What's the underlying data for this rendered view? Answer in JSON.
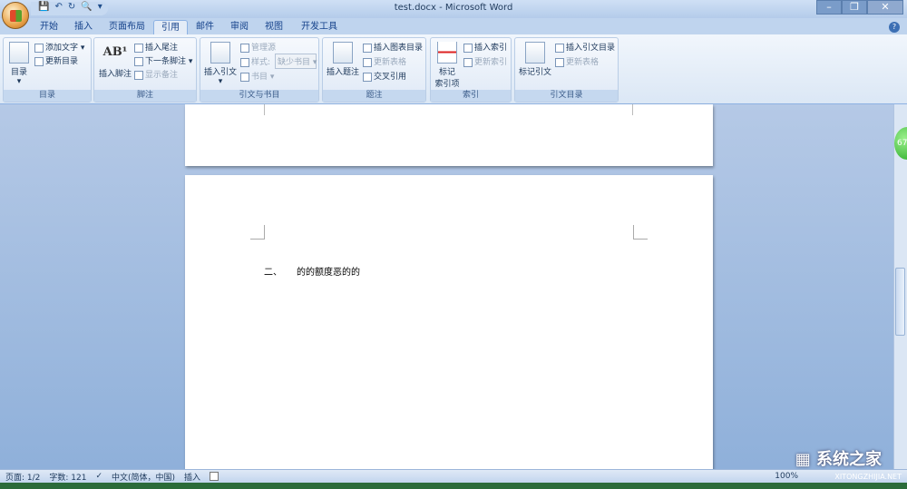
{
  "window": {
    "title": "test.docx - Microsoft Word",
    "minimize": "–",
    "restore": "❐",
    "close": "✕"
  },
  "qat": {
    "save": "💾",
    "undo": "↶",
    "redo": "↻",
    "preview": "🔍",
    "more": "▾"
  },
  "tabs": [
    "开始",
    "插入",
    "页面布局",
    "引用",
    "邮件",
    "审阅",
    "视图",
    "开发工具"
  ],
  "active_tab": "引用",
  "help": "?",
  "ribbon": {
    "toc": {
      "label": "目录",
      "big": "目录",
      "add_text": "添加文字 ▾",
      "update": "更新目录"
    },
    "footnote": {
      "label": "脚注",
      "big": "插入脚注",
      "icon": "AB¹",
      "endnote": "插入尾注",
      "next": "下一条脚注 ▾",
      "show": "显示备注"
    },
    "citation": {
      "label": "引文与书目",
      "big": "插入引文",
      "manage": "管理源",
      "style_label": "样式:",
      "style_value": "缺少书目",
      "bibliography": "书目 ▾"
    },
    "caption": {
      "label": "题注",
      "big": "插入题注",
      "table_figures": "插入图表目录",
      "update_table": "更新表格",
      "cross_ref": "交叉引用"
    },
    "index": {
      "label": "索引",
      "big1": "标记",
      "big2": "索引项",
      "insert": "插入索引",
      "update": "更新索引"
    },
    "toa": {
      "label": "引文目录",
      "big": "标记引文",
      "insert": "插入引文目录",
      "update": "更新表格"
    }
  },
  "document": {
    "heading_number": "二、",
    "heading_text": "的的额度恶的的"
  },
  "zoom_badge": "67",
  "status": {
    "page": "页面: 1/2",
    "words": "字数: 121",
    "language": "中文(简体，中国)",
    "mode": "插入",
    "zoom": "100%"
  },
  "watermark": {
    "text": "系统之家",
    "url": "XITONGZHIJIA.NET"
  }
}
